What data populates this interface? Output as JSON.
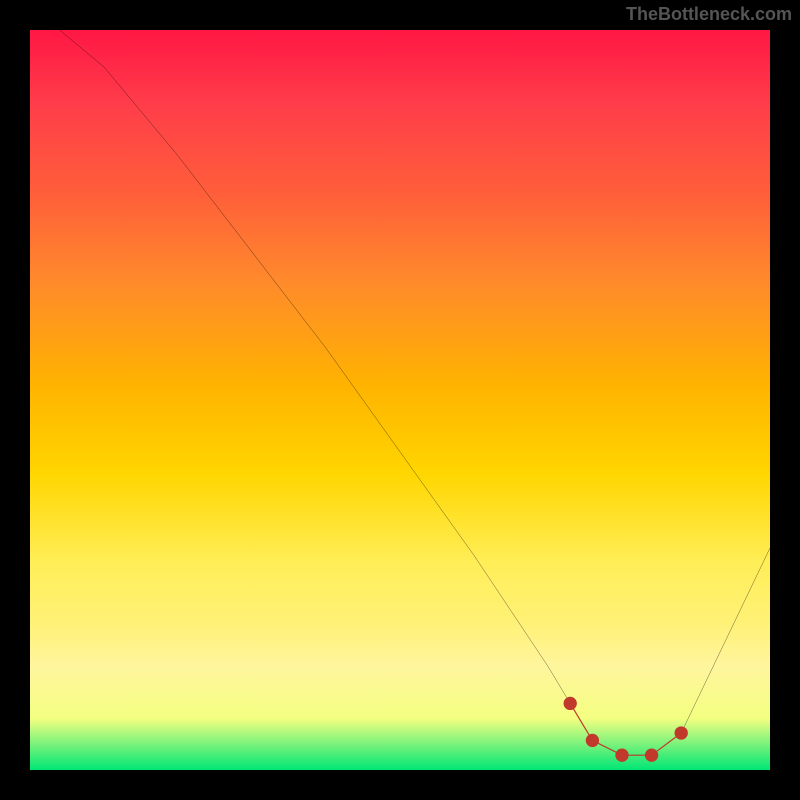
{
  "watermark": "TheBottleneck.com",
  "chart_data": {
    "type": "line",
    "title": "",
    "xlabel": "",
    "ylabel": "",
    "xlim": [
      0,
      100
    ],
    "ylim": [
      0,
      100
    ],
    "series": [
      {
        "name": "bottleneck-curve",
        "x": [
          4,
          10,
          20,
          30,
          40,
          50,
          60,
          70,
          73,
          76,
          80,
          84,
          88,
          100
        ],
        "y": [
          100,
          95,
          83,
          70,
          57,
          43,
          29,
          14,
          9,
          4,
          2,
          2,
          5,
          30
        ],
        "color": "#000000"
      },
      {
        "name": "sweet-spot-highlight",
        "x": [
          73,
          76,
          80,
          84,
          88
        ],
        "y": [
          9,
          4,
          2,
          2,
          5
        ],
        "color": "#c0392b"
      }
    ]
  },
  "colors": {
    "background": "#000000",
    "gradient_top": "#ff1744",
    "gradient_bottom": "#00e676",
    "curve": "#000000",
    "highlight": "#c0392b",
    "watermark": "#555555"
  }
}
